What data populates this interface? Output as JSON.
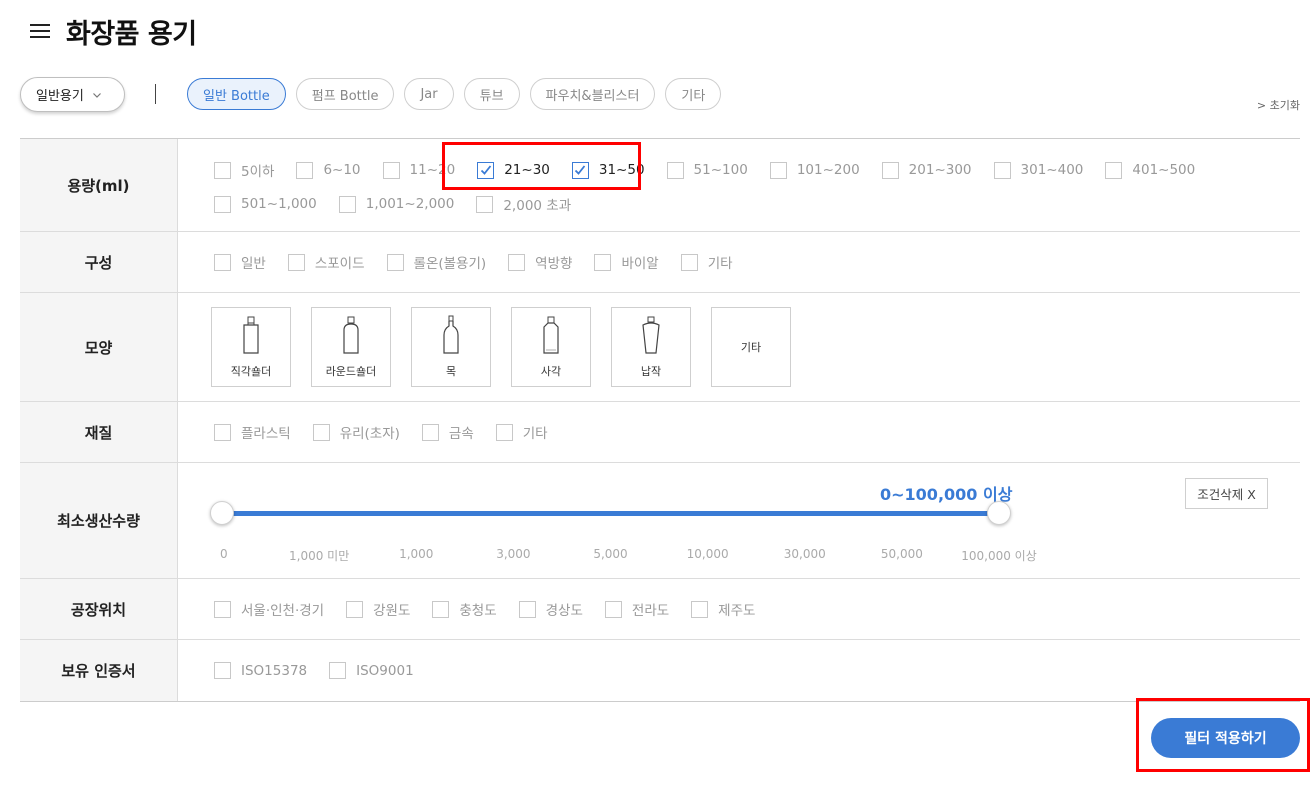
{
  "header": {
    "title": "화장품 용기",
    "menu_icon": "hamburger-menu-icon"
  },
  "category_select": {
    "value": "일반용기"
  },
  "type_chips": [
    {
      "label": "일반 Bottle",
      "active": true
    },
    {
      "label": "펌프 Bottle",
      "active": false
    },
    {
      "label": "Jar",
      "active": false
    },
    {
      "label": "튜브",
      "active": false
    },
    {
      "label": "파우치&블리스터",
      "active": false
    },
    {
      "label": "기타",
      "active": false
    }
  ],
  "reset_label": "> 초기화",
  "filters": {
    "volume": {
      "label": "용량(ml)",
      "options": [
        {
          "label": "5이하",
          "checked": false
        },
        {
          "label": "6~10",
          "checked": false
        },
        {
          "label": "11~20",
          "checked": false
        },
        {
          "label": "21~30",
          "checked": true
        },
        {
          "label": "31~50",
          "checked": true
        },
        {
          "label": "51~100",
          "checked": false
        },
        {
          "label": "101~200",
          "checked": false
        },
        {
          "label": "201~300",
          "checked": false
        },
        {
          "label": "301~400",
          "checked": false
        },
        {
          "label": "401~500",
          "checked": false
        },
        {
          "label": "501~1,000",
          "checked": false
        },
        {
          "label": "1,001~2,000",
          "checked": false
        },
        {
          "label": "2,000 초과",
          "checked": false
        }
      ]
    },
    "composition": {
      "label": "구성",
      "options": [
        {
          "label": "일반",
          "checked": false
        },
        {
          "label": "스포이드",
          "checked": false
        },
        {
          "label": "롤온(볼용기)",
          "checked": false
        },
        {
          "label": "역방향",
          "checked": false
        },
        {
          "label": "바이알",
          "checked": false
        },
        {
          "label": "기타",
          "checked": false
        }
      ]
    },
    "shape": {
      "label": "모양",
      "options": [
        {
          "label": "직각숄더",
          "icon": "square-shoulder-bottle-icon"
        },
        {
          "label": "라운드숄더",
          "icon": "round-shoulder-bottle-icon"
        },
        {
          "label": "목",
          "icon": "neck-bottle-icon"
        },
        {
          "label": "사각",
          "icon": "square-bottle-icon"
        },
        {
          "label": "납작",
          "icon": "flat-bottle-icon"
        },
        {
          "label": "기타",
          "icon": ""
        }
      ]
    },
    "material": {
      "label": "재질",
      "options": [
        {
          "label": "플라스틱",
          "checked": false
        },
        {
          "label": "유리(초자)",
          "checked": false
        },
        {
          "label": "금속",
          "checked": false
        },
        {
          "label": "기타",
          "checked": false
        }
      ]
    },
    "min_quantity": {
      "label": "최소생산수량",
      "value_text": "0~100,000 이상",
      "range": [
        0,
        1
      ],
      "ticks": [
        "0",
        "1,000 미만",
        "1,000",
        "3,000",
        "5,000",
        "10,000",
        "30,000",
        "50,000",
        "100,000 이상"
      ],
      "clear_label": "조건삭제 X"
    },
    "factory_location": {
      "label": "공장위치",
      "options": [
        {
          "label": "서울·인천·경기",
          "checked": false
        },
        {
          "label": "강원도",
          "checked": false
        },
        {
          "label": "충청도",
          "checked": false
        },
        {
          "label": "경상도",
          "checked": false
        },
        {
          "label": "전라도",
          "checked": false
        },
        {
          "label": "제주도",
          "checked": false
        }
      ]
    },
    "certificates": {
      "label": "보유 인증서",
      "options": [
        {
          "label": "ISO15378",
          "checked": false
        },
        {
          "label": "ISO9001",
          "checked": false
        }
      ]
    }
  },
  "apply_button": {
    "label": "필터 적용하기"
  },
  "colors": {
    "accent": "#3a7bd5",
    "highlight": "#ff0000"
  }
}
